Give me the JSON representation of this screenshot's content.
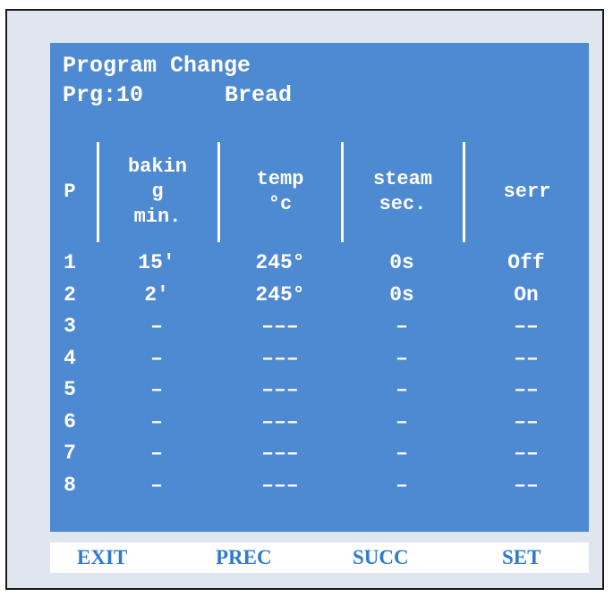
{
  "header": {
    "title": "Program Change",
    "prg_label": "Prg:10",
    "program_name": "Bread"
  },
  "columns": [
    {
      "name": "P"
    },
    {
      "name": "bakin\ng\nmin."
    },
    {
      "name": "temp\n°c"
    },
    {
      "name": "steam\nsec."
    },
    {
      "name": "serr"
    }
  ],
  "rows": [
    [
      "1",
      "15′",
      "245°",
      "0s",
      "Off"
    ],
    [
      "2",
      "2′",
      "245°",
      "0s",
      "On"
    ],
    [
      "3",
      "–",
      "–––",
      "–",
      "––"
    ],
    [
      "4",
      "–",
      "–––",
      "–",
      "––"
    ],
    [
      "5",
      "–",
      "–––",
      "–",
      "––"
    ],
    [
      "6",
      "–",
      "–––",
      "–",
      "––"
    ],
    [
      "7",
      "–",
      "–––",
      "–",
      "––"
    ],
    [
      "8",
      "–",
      "–––",
      "–",
      "––"
    ]
  ],
  "softkeys": {
    "exit": "EXIT",
    "prec": "PREC",
    "succ": "SUCC",
    "set": "SET"
  }
}
